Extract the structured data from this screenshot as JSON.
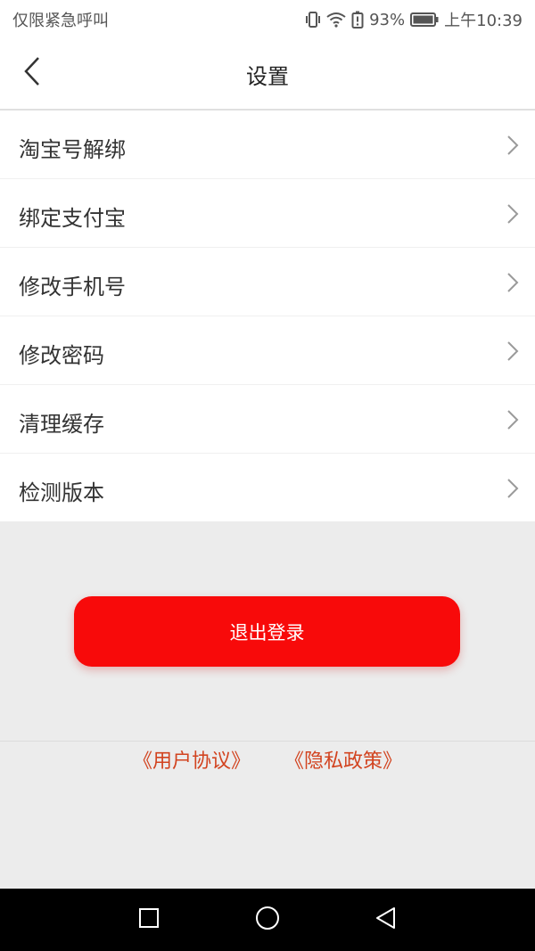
{
  "status_bar": {
    "carrier": "仅限紧急呼叫",
    "battery": "93%",
    "time": "上午10:39",
    "icons": [
      "vibrate-icon",
      "wifi-icon",
      "battery-alert-icon",
      "battery-icon"
    ]
  },
  "header": {
    "title": "设置",
    "back_icon": "back-arrow-icon"
  },
  "menu": {
    "items": [
      {
        "label": "淘宝号解绑"
      },
      {
        "label": "绑定支付宝"
      },
      {
        "label": "修改手机号"
      },
      {
        "label": "修改密码"
      },
      {
        "label": "清理缓存"
      },
      {
        "label": "检测版本"
      }
    ],
    "chevron_icon": "chevron-right-icon"
  },
  "logout": {
    "label": "退出登录"
  },
  "links": {
    "user_agreement": "《用户协议》",
    "privacy_policy": "《隐私政策》"
  },
  "nav_bar": {
    "icons": [
      "recent-apps-icon",
      "home-icon",
      "back-icon"
    ]
  },
  "colors": {
    "accent": "#f80a0a",
    "link": "#d2431f",
    "background": "#ececec"
  }
}
